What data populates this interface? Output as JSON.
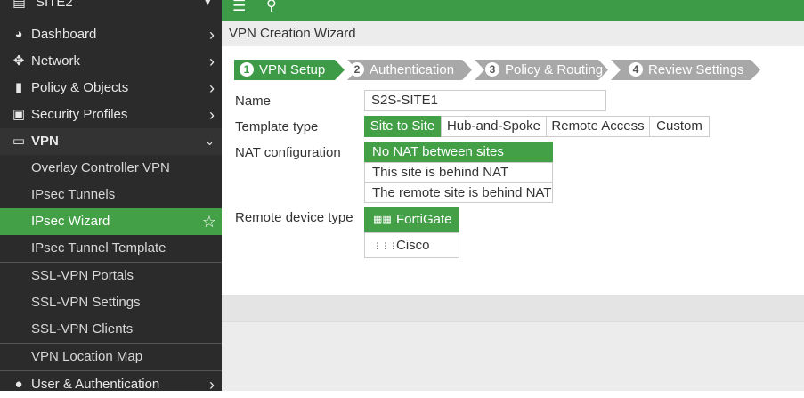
{
  "sidebar": {
    "site_label": "SITE2",
    "items": [
      {
        "label": "Dashboard",
        "icon": "dashboard-icon"
      },
      {
        "label": "Network",
        "icon": "network-icon"
      },
      {
        "label": "Policy & Objects",
        "icon": "policy-icon"
      },
      {
        "label": "Security Profiles",
        "icon": "lock-icon"
      },
      {
        "label": "VPN",
        "icon": "monitor-icon"
      }
    ],
    "vpn_sub": [
      {
        "label": "Overlay Controller VPN"
      },
      {
        "label": "IPsec Tunnels"
      },
      {
        "label": "IPsec Wizard"
      },
      {
        "label": "IPsec Tunnel Template"
      },
      {
        "label": "SSL-VPN Portals"
      },
      {
        "label": "SSL-VPN Settings"
      },
      {
        "label": "SSL-VPN Clients"
      },
      {
        "label": "VPN Location Map"
      }
    ],
    "bottom_item": {
      "label": "User & Authentication",
      "icon": "user-icon"
    }
  },
  "breadcrumb": "VPN Creation Wizard",
  "steps": [
    {
      "num": "1",
      "label": "VPN Setup"
    },
    {
      "num": "2",
      "label": "Authentication"
    },
    {
      "num": "3",
      "label": "Policy & Routing"
    },
    {
      "num": "4",
      "label": "Review Settings"
    }
  ],
  "form": {
    "name_label": "Name",
    "name_value": "S2S-SITE1",
    "template_label": "Template type",
    "template_options": [
      "Site to Site",
      "Hub-and-Spoke",
      "Remote Access",
      "Custom"
    ],
    "nat_label": "NAT configuration",
    "nat_options": [
      "No NAT between sites",
      "This site is behind NAT",
      "The remote site is behind NAT"
    ],
    "device_label": "Remote device type",
    "device_options": [
      "FortiGate",
      "Cisco"
    ]
  },
  "colors": {
    "accent": "#43a047",
    "sidebar_bg": "#2b2b2b"
  }
}
